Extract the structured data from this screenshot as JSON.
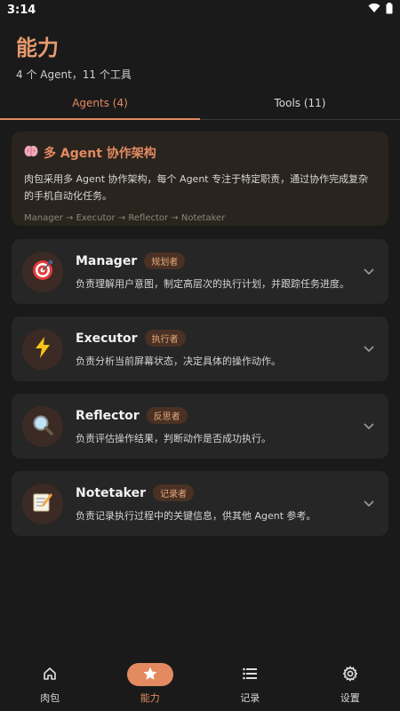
{
  "status_bar": {
    "time": "3:14"
  },
  "header": {
    "title": "能力",
    "subtitle": "4 个 Agent，11 个工具"
  },
  "tabs": [
    {
      "label": "Agents (4)",
      "active": true
    },
    {
      "label": "Tools (11)",
      "active": false
    }
  ],
  "intro": {
    "title": "多 Agent 协作架构",
    "description": "肉包采用多 Agent 协作架构，每个 Agent 专注于特定职责，通过协作完成复杂的手机自动化任务。",
    "flow": "Manager → Executor → Reflector → Notetaker"
  },
  "agents": [
    {
      "name": "Manager",
      "role": "规划者",
      "description": "负责理解用户意图，制定高层次的执行计划，并跟踪任务进度。",
      "icon": "target-icon"
    },
    {
      "name": "Executor",
      "role": "执行者",
      "description": "负责分析当前屏幕状态，决定具体的操作动作。",
      "icon": "lightning-icon"
    },
    {
      "name": "Reflector",
      "role": "反思者",
      "description": "负责评估操作结果，判断动作是否成功执行。",
      "icon": "magnifier-icon"
    },
    {
      "name": "Notetaker",
      "role": "记录者",
      "description": "负责记录执行过程中的关键信息，供其他 Agent 参考。",
      "icon": "memo-icon"
    }
  ],
  "bottom_nav": [
    {
      "label": "肉包",
      "icon": "home-icon",
      "active": false
    },
    {
      "label": "能力",
      "icon": "star-icon",
      "active": true
    },
    {
      "label": "记录",
      "icon": "list-icon",
      "active": false
    },
    {
      "label": "设置",
      "icon": "gear-icon",
      "active": false
    }
  ],
  "colors": {
    "accent": "#e38a61",
    "background": "#1a1a1a",
    "card": "#262626"
  }
}
